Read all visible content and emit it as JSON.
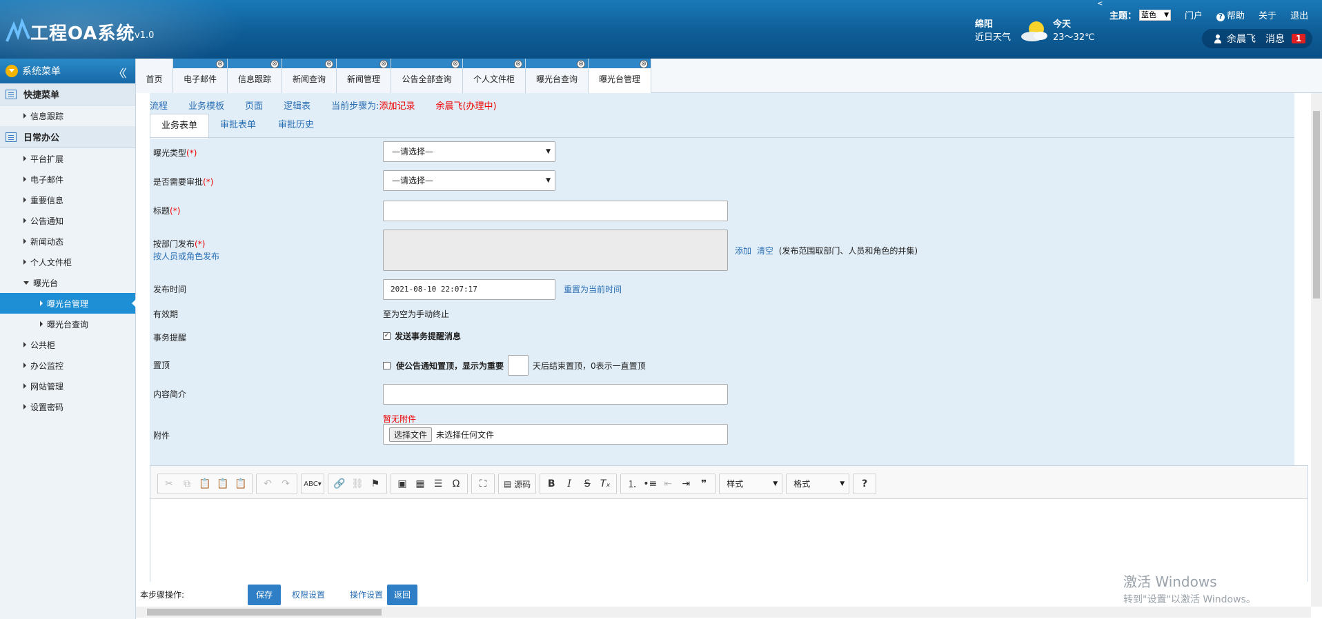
{
  "header": {
    "title": "工程OA系统",
    "version": "v1.0",
    "weather_city": "绵阳",
    "weather_label": "近日天气",
    "weather_day": "今天",
    "weather_temp": "23～32℃",
    "corner_glyph": "<",
    "theme_label": "主题：",
    "theme_value": "蓝色",
    "portal": "门户",
    "help": "帮助",
    "about": "关于",
    "logout": "退出",
    "user_name": "余晨飞",
    "messages_label": "消息",
    "messages_count": "1"
  },
  "sidebar": {
    "title": "系统菜单",
    "groups": [
      {
        "label": "快捷菜单",
        "items": [
          {
            "label": "信息跟踪"
          }
        ]
      },
      {
        "label": "日常办公",
        "items": [
          {
            "label": "平台扩展"
          },
          {
            "label": "电子邮件"
          },
          {
            "label": "重要信息"
          },
          {
            "label": "公告通知"
          },
          {
            "label": "新闻动态"
          },
          {
            "label": "个人文件柜"
          },
          {
            "label": "曝光台"
          },
          {
            "label": "曝光台管理"
          },
          {
            "label": "曝光台查询"
          },
          {
            "label": "公共柜"
          },
          {
            "label": "办公监控"
          },
          {
            "label": "网站管理"
          },
          {
            "label": "设置密码"
          }
        ]
      }
    ]
  },
  "tabs": [
    {
      "label": "首页"
    },
    {
      "label": "电子邮件"
    },
    {
      "label": "信息跟踪"
    },
    {
      "label": "新闻查询"
    },
    {
      "label": "新闻管理"
    },
    {
      "label": "公告全部查询"
    },
    {
      "label": "个人文件柜"
    },
    {
      "label": "曝光台查询"
    },
    {
      "label": "曝光台管理"
    }
  ],
  "close_glyph": "⊗",
  "steps": {
    "flow": "流程",
    "template": "业务模板",
    "page": "页面",
    "logic": "逻辑表",
    "current_label": "当前步骤为:",
    "current_value": "添加记录",
    "handler": "余晨飞(办理中)"
  },
  "form_tabs": [
    {
      "label": "业务表单"
    },
    {
      "label": "审批表单"
    },
    {
      "label": "审批历史"
    }
  ],
  "form": {
    "required_mark": "(*)",
    "type_label": "曝光类型",
    "type_value": "—请选择—",
    "approval_label": "是否需要审批",
    "approval_value": "—请选择—",
    "title_label": "标题",
    "dept_label": "按部门发布",
    "person_label": "按人员或角色发布",
    "add_link": "添加",
    "clear_link": "清空",
    "scope_note": "(发布范围取部门、人员和角色的并集)",
    "time_label": "发布时间",
    "time_value": "2021-08-10 22:07:17",
    "reset_time": "重置为当前时间",
    "validity_label": "有效期",
    "validity_value": "至为空为手动终止",
    "reminder_label": "事务提醒",
    "reminder_text": "发送事务提醒消息",
    "top_label": "置顶",
    "top_text": "使公告通知置顶，显示为重要",
    "top_suffix": "天后结束置顶，0表示一直置顶",
    "summary_label": "内容简介",
    "attachment_label": "附件",
    "no_attachment": "暂无附件",
    "choose_file": "选择文件",
    "no_file": "未选择任何文件"
  },
  "editor": {
    "source": "源码",
    "style_dropdown": "样式",
    "format_dropdown": "格式"
  },
  "bottom": {
    "step_ops": "本步骤操作:",
    "save": "保存",
    "permissions": "权限设置",
    "op_settings": "操作设置",
    "back": "返回"
  },
  "watermark": {
    "line1": "激活 Windows",
    "line2": "转到\"设置\"以激活 Windows。"
  }
}
